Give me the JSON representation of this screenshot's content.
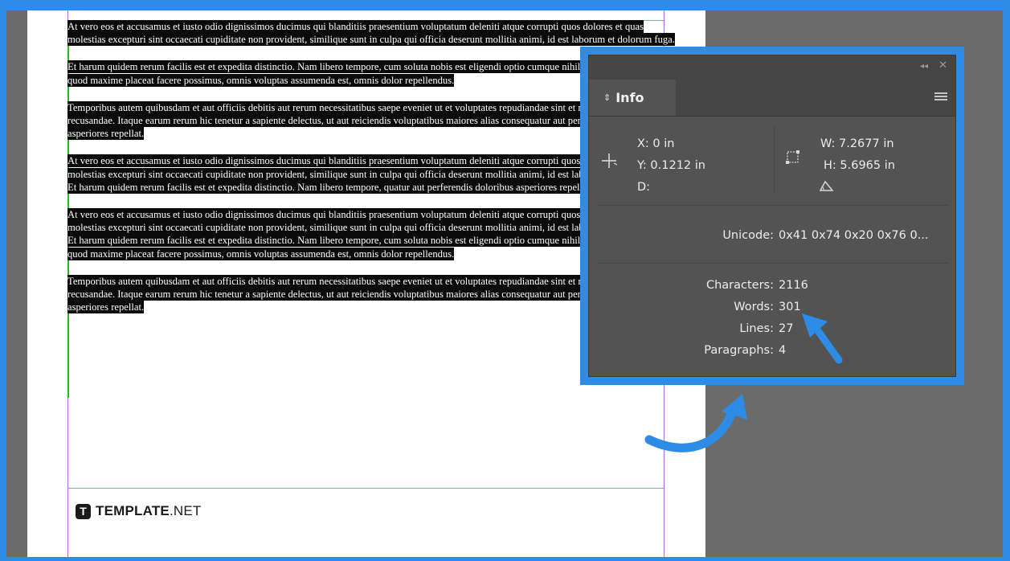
{
  "document": {
    "paragraphs": [
      "At vero eos et accusamus et iusto odio dignissimos ducimus qui blanditiis praesentium voluptatum deleniti atque corrupti quos dolores et quas molestias excepturi sint occaecati cupiditate non provident, similique sunt in culpa qui officia deserunt mollitia animi, id est laborum et dolorum fuga.",
      "Et harum quidem rerum facilis est et expedita distinctio. Nam libero tempore, cum soluta nobis est eligendi optio cumque nihil impedit quo minus id quod maxime placeat facere possimus, omnis voluptas assumenda est, omnis dolor repellendus.",
      "Temporibus autem quibusdam et aut officiis debitis aut rerum necessitatibus saepe eveniet ut et voluptates repudiandae sint et molestiae non recusandae. Itaque earum rerum hic tenetur a sapiente delectus, ut aut reiciendis voluptatibus maiores alias consequatur aut perferendis doloribus asperiores repellat.",
      "At vero eos et accusamus et iusto odio dignissimos ducimus qui blanditiis praesentium voluptatum deleniti atque corrupti quos dolores et quas molestias excepturi sint occaecati cupiditate non provident, similique sunt in culpa qui officia deserunt mollitia animi, id est laborum et dolorum fuga. Et harum quidem rerum facilis est et expedita distinctio. Nam libero tempore, quatur aut perferendis doloribus asperiores repellat.",
      "At vero eos et accusamus et iusto odio dignissimos ducimus qui blanditiis praesentium voluptatum deleniti atque corrupti quos dolores et quas molestias excepturi sint occaecati cupiditate non provident, similique sunt in culpa qui officia deserunt mollitia animi, id est laborum et dolorum fuga. Et harum quidem rerum facilis est et expedita distinctio. Nam libero tempore, cum soluta nobis est eligendi optio cumque nihil impedit quo minus id quod maxime placeat facere possimus, omnis voluptas assumenda est, omnis dolor repellendus.",
      "Temporibus autem quibusdam et aut officiis debitis aut rerum necessitatibus saepe eveniet ut et voluptates repudiandae sint et molestiae non recusandae. Itaque earum rerum hic tenetur a sapiente delectus, ut aut reiciendis voluptatibus maiores alias consequatur aut perferendis doloribus asperiores repellat."
    ]
  },
  "logo": {
    "mark": "T",
    "bold": "TEMPLATE",
    "rest": ".NET"
  },
  "info_panel": {
    "tab_label": "Info",
    "collapse_glyph": "◂◂",
    "close_glyph": "✕",
    "x": "X: 0 in",
    "y": "Y: 0.1212 in",
    "d": "D:",
    "w": "W: 7.2677 in",
    "h": "H: 5.6965 in",
    "unicode_label": "Unicode:",
    "unicode_value": "0x41 0x74 0x20 0x76 0...",
    "characters_label": "Characters:",
    "characters_value": "2116",
    "words_label": "Words:",
    "words_value": "301",
    "lines_label": "Lines:",
    "lines_value": "27",
    "paragraphs_label": "Paragraphs:",
    "paragraphs_value": "4"
  },
  "colors": {
    "accent": "#2f8ce6",
    "panel_bg": "#535353",
    "selection": "#0b0b0b"
  }
}
